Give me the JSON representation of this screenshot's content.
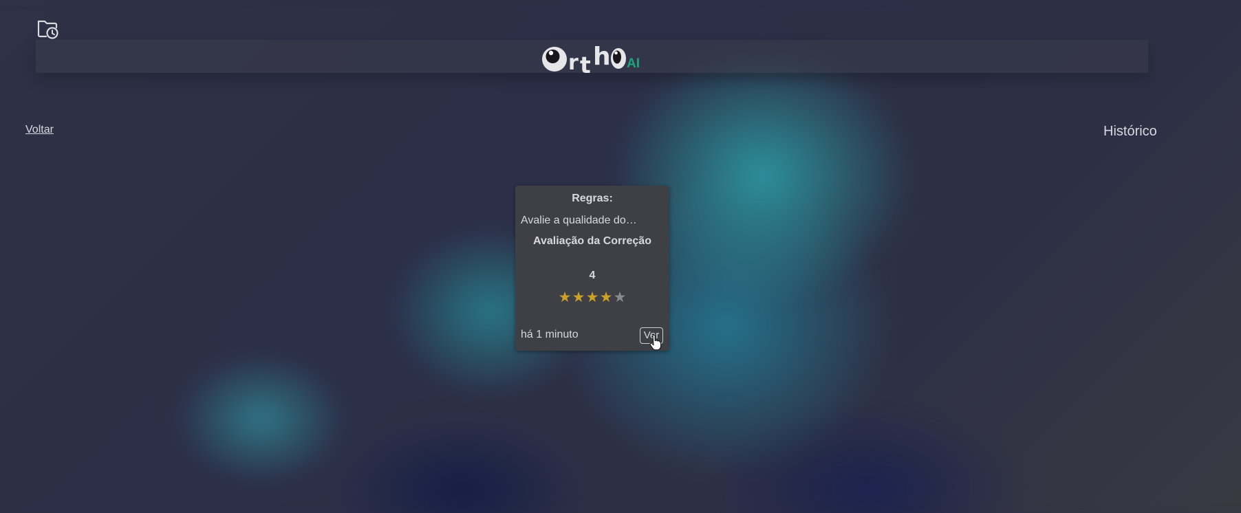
{
  "header": {
    "logo_text": "OrthoAI",
    "logo_suffix": "AI",
    "history_icon": "folder-clock-icon"
  },
  "nav": {
    "back_label": "Voltar",
    "history_heading": "Histórico"
  },
  "card": {
    "rules_label": "Regras:",
    "rules_text": "Avalie a qualidade dos…",
    "evaluation_title": "Avaliação da Correção",
    "score": "4",
    "rating": 4,
    "rating_max": 5,
    "time": "há 1 minuto",
    "view_label": "Ver"
  },
  "colors": {
    "star_on": "#c9a227",
    "star_off": "#8a8b92",
    "logo_accent": "#1fa37a"
  }
}
